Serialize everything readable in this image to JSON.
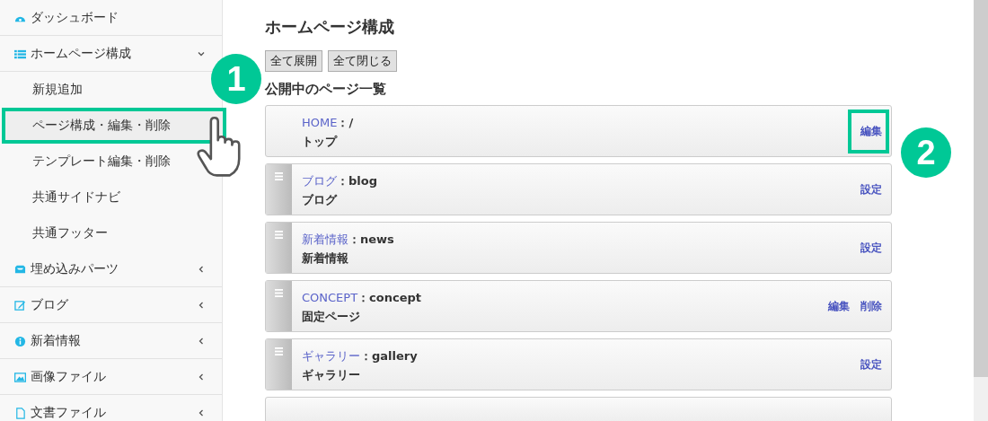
{
  "sidebar": {
    "items": [
      {
        "label": "ダッシュボード",
        "has_caret": false
      },
      {
        "label": "ホームページ構成",
        "expanded": true,
        "has_caret": true,
        "children": [
          {
            "label": "新規追加",
            "selected": false,
            "framed": false
          },
          {
            "label": "ページ構成・編集・削除",
            "selected": true,
            "framed": true
          },
          {
            "label": "テンプレート編集・削除",
            "selected": false,
            "framed": false
          },
          {
            "label": "共通サイドナビ",
            "selected": false,
            "framed": false
          },
          {
            "label": "共通フッター",
            "selected": false,
            "framed": false
          }
        ]
      },
      {
        "label": "埋め込みパーツ",
        "expanded": false,
        "has_caret": true
      },
      {
        "label": "ブログ",
        "expanded": false,
        "has_caret": true
      },
      {
        "label": "新着情報",
        "expanded": false,
        "has_caret": true
      },
      {
        "label": "画像ファイル",
        "expanded": false,
        "has_caret": true
      },
      {
        "label": "文書ファイル",
        "expanded": false,
        "has_caret": true
      }
    ]
  },
  "title": "ホームページ構成",
  "buttons": [
    "全て展開",
    "全て閉じる"
  ],
  "list_title": "公開中のページ一覧",
  "pages": [
    {
      "name": "HOME",
      "slug": "：/",
      "title": "トップ",
      "draggable": false,
      "actions": [
        {
          "label": "編集",
          "framed": true
        }
      ]
    },
    {
      "name": "ブログ",
      "slug": "：blog",
      "title": "ブログ",
      "draggable": true,
      "actions": [
        {
          "label": "設定",
          "framed": false
        }
      ]
    },
    {
      "name": "新着情報",
      "slug": "：news",
      "title": "新着情報",
      "draggable": true,
      "actions": [
        {
          "label": "設定",
          "framed": false
        }
      ]
    },
    {
      "name": "CONCEPT",
      "slug": "：concept",
      "title": "固定ページ",
      "draggable": true,
      "actions": [
        {
          "label": "編集",
          "framed": false
        },
        {
          "label": "削除",
          "framed": false
        }
      ]
    },
    {
      "name": "ギャラリー",
      "slug": "：gallery",
      "title": "ギャラリー",
      "draggable": true,
      "actions": [
        {
          "label": "設定",
          "framed": false
        }
      ]
    }
  ],
  "callouts": [
    {
      "label": "1"
    },
    {
      "label": "2"
    }
  ]
}
